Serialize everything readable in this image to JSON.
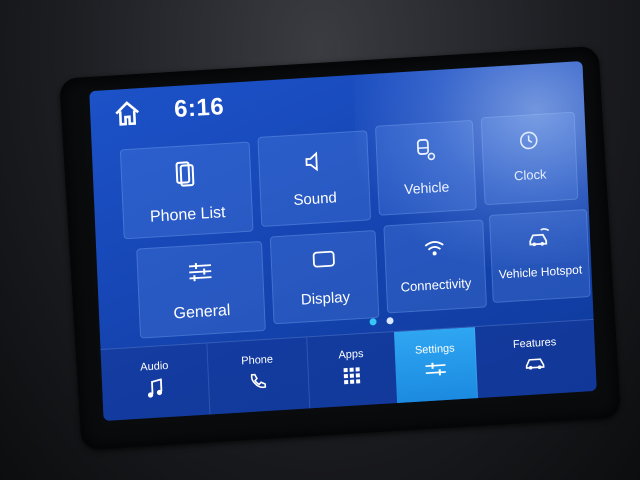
{
  "status": {
    "time": "6:16"
  },
  "settings_grid": {
    "tiles": [
      {
        "label": "Phone List",
        "icon": "phone-list-icon"
      },
      {
        "label": "Sound",
        "icon": "speaker-icon"
      },
      {
        "label": "Vehicle",
        "icon": "vehicle-settings-icon"
      },
      {
        "label": "Clock",
        "icon": "clock-icon"
      },
      {
        "label": "General",
        "icon": "sliders-icon"
      },
      {
        "label": "Display",
        "icon": "display-icon"
      },
      {
        "label": "Connectivity",
        "icon": "wifi-icon"
      },
      {
        "label": "Vehicle Hotspot",
        "icon": "hotspot-car-icon"
      }
    ],
    "page_count": 2,
    "active_page": 1
  },
  "bottom_nav": [
    {
      "label": "Audio",
      "icon": "music-note-icon"
    },
    {
      "label": "Phone",
      "icon": "phone-handset-icon"
    },
    {
      "label": "Apps",
      "icon": "apps-grid-icon"
    },
    {
      "label": "Settings",
      "icon": "settings-sliders-icon",
      "active": true
    },
    {
      "label": "Features",
      "icon": "car-features-icon"
    }
  ],
  "colors": {
    "screen_blue": "#1747b6",
    "active_nav": "#2fa6f2",
    "dot_active": "#37c6f5",
    "text": "#ffffff"
  }
}
